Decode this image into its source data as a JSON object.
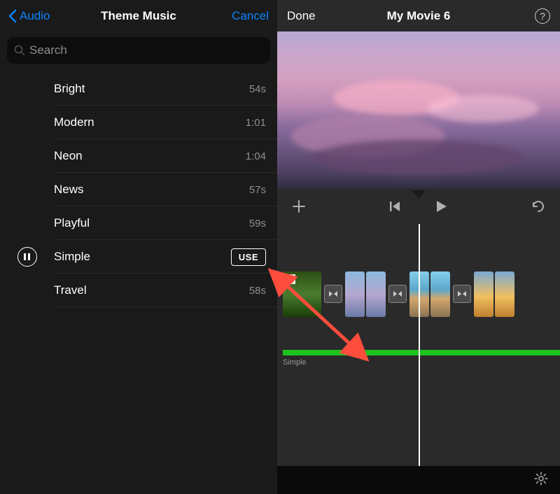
{
  "left": {
    "back_label": "Audio",
    "title": "Theme Music",
    "cancel_label": "Cancel",
    "search_placeholder": "Search",
    "tracks": [
      {
        "name": "Bright",
        "duration": "54s",
        "playing": false
      },
      {
        "name": "Modern",
        "duration": "1:01",
        "playing": false
      },
      {
        "name": "Neon",
        "duration": "1:04",
        "playing": false
      },
      {
        "name": "News",
        "duration": "57s",
        "playing": false
      },
      {
        "name": "Playful",
        "duration": "59s",
        "playing": false
      },
      {
        "name": "Simple",
        "duration": "",
        "playing": true,
        "use_label": "USE"
      },
      {
        "name": "Travel",
        "duration": "58s",
        "playing": false
      }
    ]
  },
  "right": {
    "done_label": "Done",
    "title": "My Movie 6",
    "help_label": "?",
    "audio_track_label": "Simple"
  },
  "colors": {
    "accent": "#0a84ff",
    "audio_track": "#1dc41d"
  }
}
